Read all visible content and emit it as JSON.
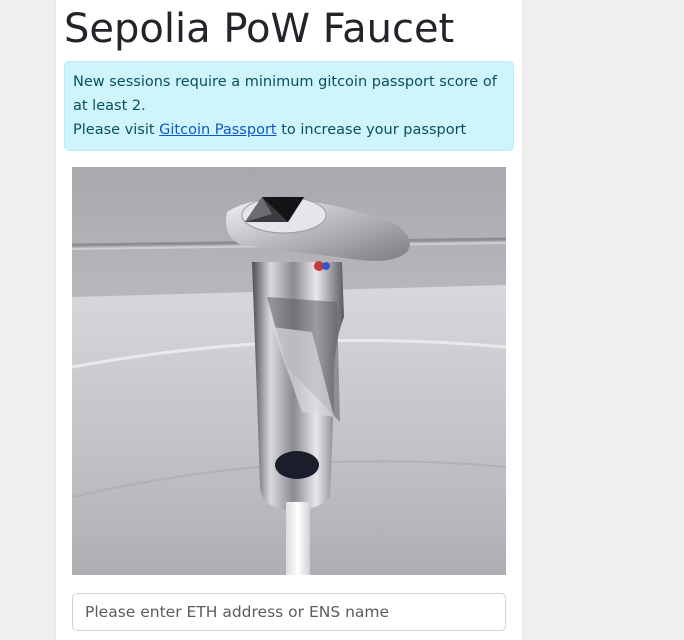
{
  "page": {
    "title": "Sepolia PoW Faucet"
  },
  "notice": {
    "line1": "New sessions require a minimum gitcoin passport score of at least 2.",
    "line2_prefix": "Please visit ",
    "link_text": "Gitcoin Passport",
    "line2_suffix": " to increase your passport score."
  },
  "faucet_image": {
    "description": "Photo of a chrome bathroom faucet with the Ethereum logo on top"
  },
  "address_input": {
    "value": "",
    "placeholder": "Please enter ETH address or ENS name"
  },
  "colors": {
    "alert_background": "#cff4fc",
    "alert_text": "#055160",
    "link": "#0a58ca",
    "page_background": "#efefef"
  }
}
